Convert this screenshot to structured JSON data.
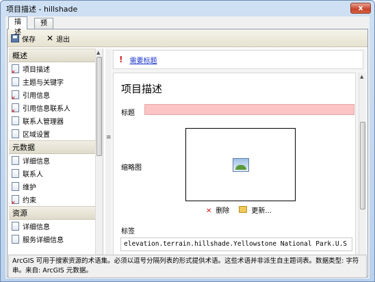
{
  "window": {
    "title": "项目描述 - hillshade",
    "close_label": "x"
  },
  "tabs": [
    {
      "label": "描述"
    },
    {
      "label": "预览"
    }
  ],
  "toolbar": {
    "save_label": "保存",
    "exit_label": "退出"
  },
  "sidebar": {
    "groups": [
      {
        "title": "概述",
        "items": [
          {
            "label": "项目描述",
            "icon": "doc-error-icon"
          },
          {
            "label": "主题与关键字",
            "icon": "doc-icon"
          },
          {
            "label": "引用信息",
            "icon": "doc-error-icon"
          },
          {
            "label": "引用信息联系人",
            "icon": "doc-error-icon"
          },
          {
            "label": "联系人管理器",
            "icon": "doc-icon"
          },
          {
            "label": "区域设置",
            "icon": "doc-icon"
          }
        ]
      },
      {
        "title": "元数据",
        "items": [
          {
            "label": "详细信息",
            "icon": "doc-icon"
          },
          {
            "label": "联系人",
            "icon": "doc-icon"
          },
          {
            "label": "维护",
            "icon": "doc-icon"
          },
          {
            "label": "约束",
            "icon": "doc-error-icon"
          }
        ]
      },
      {
        "title": "资源",
        "items": [
          {
            "label": "详细信息",
            "icon": "doc-icon"
          },
          {
            "label": "服务详细信息",
            "icon": "doc-icon"
          }
        ]
      }
    ]
  },
  "alert": {
    "text": "需要标题"
  },
  "form": {
    "heading": "项目描述",
    "title_label": "标题",
    "title_value": "",
    "thumbnail_label": "缩略图",
    "delete_label": "删除",
    "update_label": "更新...",
    "tags_label": "标签",
    "tags_value": "elevation.terrain.hillshade.Yellowstone National Park.U.S"
  },
  "status": {
    "text": "ArcGIS 可用于搜索资源的术语集。必须以逗号分隔列表的形式提供术语。这些术语并非派生自主题词表。数据类型: 字符串。来自: ArcGIS 元数据。"
  },
  "colors": {
    "required_field": "#fcc4c4",
    "link": "#1a33c8",
    "error": "#d21c1c"
  }
}
